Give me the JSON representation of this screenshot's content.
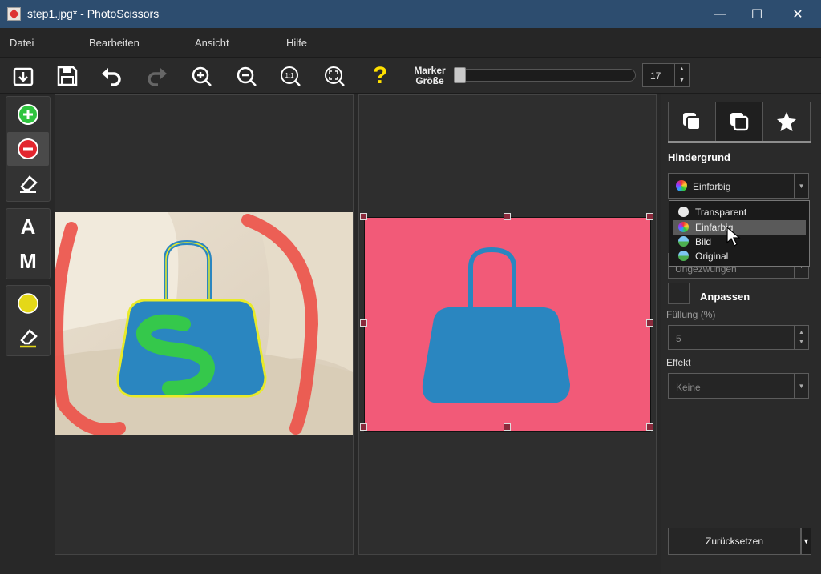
{
  "titlebar": {
    "title": "step1.jpg* - PhotoScissors",
    "minimize": "—",
    "maximize": "☐",
    "close": "✕"
  },
  "menu": [
    "Datei",
    "Bearbeiten",
    "Ansicht",
    "Hilfe"
  ],
  "toolbar": {
    "marker_label_1": "Marker",
    "marker_label_2": "Größe",
    "marker_size": "17",
    "help_glyph": "?",
    "zoom_fit_glyph": "1:1",
    "icons": [
      "open-icon",
      "save-icon",
      "undo-icon",
      "redo-icon",
      "zoom-in-icon",
      "zoom-out-icon",
      "zoom-actual-icon",
      "zoom-fit-icon",
      "help-icon"
    ]
  },
  "tools": {
    "text_tool_a": "A",
    "text_tool_m": "M"
  },
  "right_panel": {
    "section_background": "Hindergrund",
    "background_selected": "Einfarbig",
    "background_options": [
      "Transparent",
      "Einfarbig",
      "Bild",
      "Original"
    ],
    "hidden_combo_partial": "Ungezwungen",
    "fit_label": "Anpassen",
    "fill_label": "Füllung (%)",
    "fill_value": "5",
    "effect_label": "Effekt",
    "effect_value": "Keine",
    "reset_label": "Zurücksetzen"
  },
  "colors": {
    "titlebar": "#2d4d6f",
    "result_background": "#f25a78",
    "foreground_marker": "#33cc44",
    "background_marker": "#ee4444",
    "handbag": "#2a86c0"
  }
}
